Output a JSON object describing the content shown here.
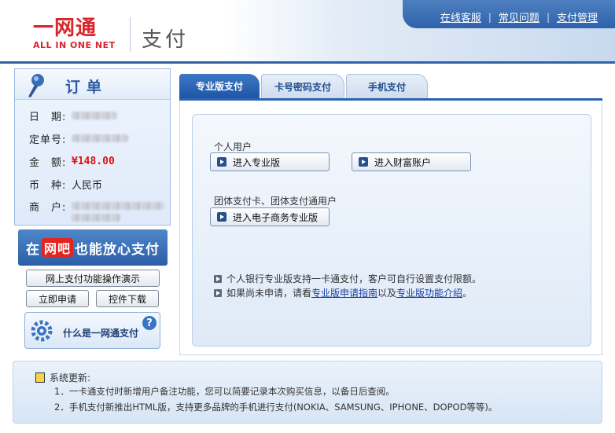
{
  "header": {
    "logo_cn": "一网通",
    "logo_en": "ALL IN ONE NET",
    "title": "支付",
    "links": [
      "在线客服",
      "常见问题",
      "支付管理"
    ]
  },
  "order": {
    "title": "订单",
    "rows": [
      {
        "label": "日　期:",
        "value": ""
      },
      {
        "label": "定单号:",
        "value": ""
      },
      {
        "label": "金　额:",
        "value": "¥148.00"
      },
      {
        "label": "币　种:",
        "value": "人民币"
      },
      {
        "label": "商　户:",
        "value": ""
      }
    ]
  },
  "promo": {
    "prefix": "在",
    "highlight": "网吧",
    "suffix": "也能放心支付"
  },
  "left_buttons": {
    "demo": "网上支付功能操作演示",
    "apply": "立即申请",
    "download": "控件下载"
  },
  "what_is": {
    "label": "什么是一网通支付"
  },
  "tabs": [
    {
      "label": "专业版支付",
      "active": true
    },
    {
      "label": "卡号密码支付",
      "active": false
    },
    {
      "label": "手机支付",
      "active": false
    }
  ],
  "personal": {
    "label": "个人用户",
    "btn_pro": "进入专业版",
    "btn_wealth": "进入财富账户"
  },
  "group": {
    "label": "团体支付卡、团体支付通用户",
    "btn_ecommerce": "进入电子商务专业版"
  },
  "notes": {
    "line1": "个人银行专业版支持一卡通支付，客户可自行设置支付限额。",
    "line2_prefix": "如果尚未申请，请看",
    "line2_link1": "专业版申请指南",
    "line2_mid": "以及",
    "line2_link2": "专业版功能介绍",
    "line2_suffix": "。"
  },
  "footer": {
    "title": "系统更新:",
    "items": [
      "1．一卡通支付时新增用户备注功能，您可以简要记录本次购买信息，以备日后查阅。",
      "2．手机支付新推出HTML版，支持更多品牌的手机进行支付(NOKIA、SAMSUNG、IPHONE、DOPOD等等)。"
    ]
  },
  "colors": {
    "brand_blue": "#2f62ab",
    "brand_red": "#d8262b",
    "amount_red": "#e3110f"
  }
}
